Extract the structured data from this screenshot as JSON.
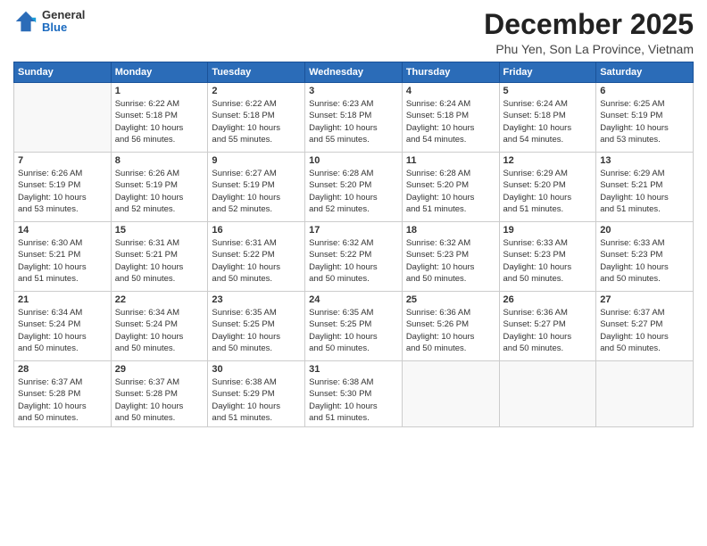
{
  "header": {
    "logo_line1": "General",
    "logo_line2": "Blue",
    "month": "December 2025",
    "location": "Phu Yen, Son La Province, Vietnam"
  },
  "weekdays": [
    "Sunday",
    "Monday",
    "Tuesday",
    "Wednesday",
    "Thursday",
    "Friday",
    "Saturday"
  ],
  "weeks": [
    [
      {
        "day": "",
        "info": ""
      },
      {
        "day": "1",
        "info": "Sunrise: 6:22 AM\nSunset: 5:18 PM\nDaylight: 10 hours\nand 56 minutes."
      },
      {
        "day": "2",
        "info": "Sunrise: 6:22 AM\nSunset: 5:18 PM\nDaylight: 10 hours\nand 55 minutes."
      },
      {
        "day": "3",
        "info": "Sunrise: 6:23 AM\nSunset: 5:18 PM\nDaylight: 10 hours\nand 55 minutes."
      },
      {
        "day": "4",
        "info": "Sunrise: 6:24 AM\nSunset: 5:18 PM\nDaylight: 10 hours\nand 54 minutes."
      },
      {
        "day": "5",
        "info": "Sunrise: 6:24 AM\nSunset: 5:18 PM\nDaylight: 10 hours\nand 54 minutes."
      },
      {
        "day": "6",
        "info": "Sunrise: 6:25 AM\nSunset: 5:19 PM\nDaylight: 10 hours\nand 53 minutes."
      }
    ],
    [
      {
        "day": "7",
        "info": "Sunrise: 6:26 AM\nSunset: 5:19 PM\nDaylight: 10 hours\nand 53 minutes."
      },
      {
        "day": "8",
        "info": "Sunrise: 6:26 AM\nSunset: 5:19 PM\nDaylight: 10 hours\nand 52 minutes."
      },
      {
        "day": "9",
        "info": "Sunrise: 6:27 AM\nSunset: 5:19 PM\nDaylight: 10 hours\nand 52 minutes."
      },
      {
        "day": "10",
        "info": "Sunrise: 6:28 AM\nSunset: 5:20 PM\nDaylight: 10 hours\nand 52 minutes."
      },
      {
        "day": "11",
        "info": "Sunrise: 6:28 AM\nSunset: 5:20 PM\nDaylight: 10 hours\nand 51 minutes."
      },
      {
        "day": "12",
        "info": "Sunrise: 6:29 AM\nSunset: 5:20 PM\nDaylight: 10 hours\nand 51 minutes."
      },
      {
        "day": "13",
        "info": "Sunrise: 6:29 AM\nSunset: 5:21 PM\nDaylight: 10 hours\nand 51 minutes."
      }
    ],
    [
      {
        "day": "14",
        "info": "Sunrise: 6:30 AM\nSunset: 5:21 PM\nDaylight: 10 hours\nand 51 minutes."
      },
      {
        "day": "15",
        "info": "Sunrise: 6:31 AM\nSunset: 5:21 PM\nDaylight: 10 hours\nand 50 minutes."
      },
      {
        "day": "16",
        "info": "Sunrise: 6:31 AM\nSunset: 5:22 PM\nDaylight: 10 hours\nand 50 minutes."
      },
      {
        "day": "17",
        "info": "Sunrise: 6:32 AM\nSunset: 5:22 PM\nDaylight: 10 hours\nand 50 minutes."
      },
      {
        "day": "18",
        "info": "Sunrise: 6:32 AM\nSunset: 5:23 PM\nDaylight: 10 hours\nand 50 minutes."
      },
      {
        "day": "19",
        "info": "Sunrise: 6:33 AM\nSunset: 5:23 PM\nDaylight: 10 hours\nand 50 minutes."
      },
      {
        "day": "20",
        "info": "Sunrise: 6:33 AM\nSunset: 5:23 PM\nDaylight: 10 hours\nand 50 minutes."
      }
    ],
    [
      {
        "day": "21",
        "info": "Sunrise: 6:34 AM\nSunset: 5:24 PM\nDaylight: 10 hours\nand 50 minutes."
      },
      {
        "day": "22",
        "info": "Sunrise: 6:34 AM\nSunset: 5:24 PM\nDaylight: 10 hours\nand 50 minutes."
      },
      {
        "day": "23",
        "info": "Sunrise: 6:35 AM\nSunset: 5:25 PM\nDaylight: 10 hours\nand 50 minutes."
      },
      {
        "day": "24",
        "info": "Sunrise: 6:35 AM\nSunset: 5:25 PM\nDaylight: 10 hours\nand 50 minutes."
      },
      {
        "day": "25",
        "info": "Sunrise: 6:36 AM\nSunset: 5:26 PM\nDaylight: 10 hours\nand 50 minutes."
      },
      {
        "day": "26",
        "info": "Sunrise: 6:36 AM\nSunset: 5:27 PM\nDaylight: 10 hours\nand 50 minutes."
      },
      {
        "day": "27",
        "info": "Sunrise: 6:37 AM\nSunset: 5:27 PM\nDaylight: 10 hours\nand 50 minutes."
      }
    ],
    [
      {
        "day": "28",
        "info": "Sunrise: 6:37 AM\nSunset: 5:28 PM\nDaylight: 10 hours\nand 50 minutes."
      },
      {
        "day": "29",
        "info": "Sunrise: 6:37 AM\nSunset: 5:28 PM\nDaylight: 10 hours\nand 50 minutes."
      },
      {
        "day": "30",
        "info": "Sunrise: 6:38 AM\nSunset: 5:29 PM\nDaylight: 10 hours\nand 51 minutes."
      },
      {
        "day": "31",
        "info": "Sunrise: 6:38 AM\nSunset: 5:30 PM\nDaylight: 10 hours\nand 51 minutes."
      },
      {
        "day": "",
        "info": ""
      },
      {
        "day": "",
        "info": ""
      },
      {
        "day": "",
        "info": ""
      }
    ]
  ]
}
